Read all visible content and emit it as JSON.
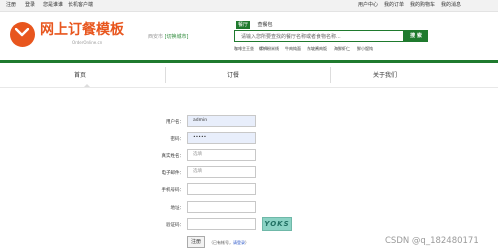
{
  "topbar": {
    "left_links": [
      "注册",
      "登录",
      "您是谁谁",
      "长机客户端"
    ],
    "right_links": [
      "用户中心",
      "我的订单",
      "我的购物车",
      "我的消息"
    ]
  },
  "brand": {
    "title": "网上订餐模板",
    "subtitle": "OrderOnline.cn",
    "city": "西安市",
    "city_switch": "[切换城市]"
  },
  "search": {
    "tabs": [
      "餐厅",
      "查餐包"
    ],
    "placeholder": "请输入您所要查找的餐厅名称或者食物名称...",
    "button": "搜 索",
    "hot_keywords": [
      "咖啡主王坐",
      "螺蛳粉米线",
      "牛肉炖面",
      "东坡酱肉饭",
      "海鲜虾仁",
      "鲜小馄饨"
    ]
  },
  "nav": {
    "items": [
      "首页",
      "订餐",
      "关于我们"
    ]
  },
  "form": {
    "username_label": "用户名：",
    "username_value": "admin",
    "password_label": "密码：",
    "password_value": "•••••",
    "realname_label": "真实姓名：",
    "realname_placeholder": "选填",
    "email_label": "电子邮件：",
    "email_placeholder": "选填",
    "phone_label": "手机号码：",
    "address_label": "地址：",
    "captcha_label": "验证码：",
    "captcha_text": "YOKS",
    "register_button": "注册",
    "login_prompt": "（已有帐号，",
    "login_link": "请登录",
    "login_suffix": "）"
  },
  "watermark": "CSDN @q_182480171"
}
